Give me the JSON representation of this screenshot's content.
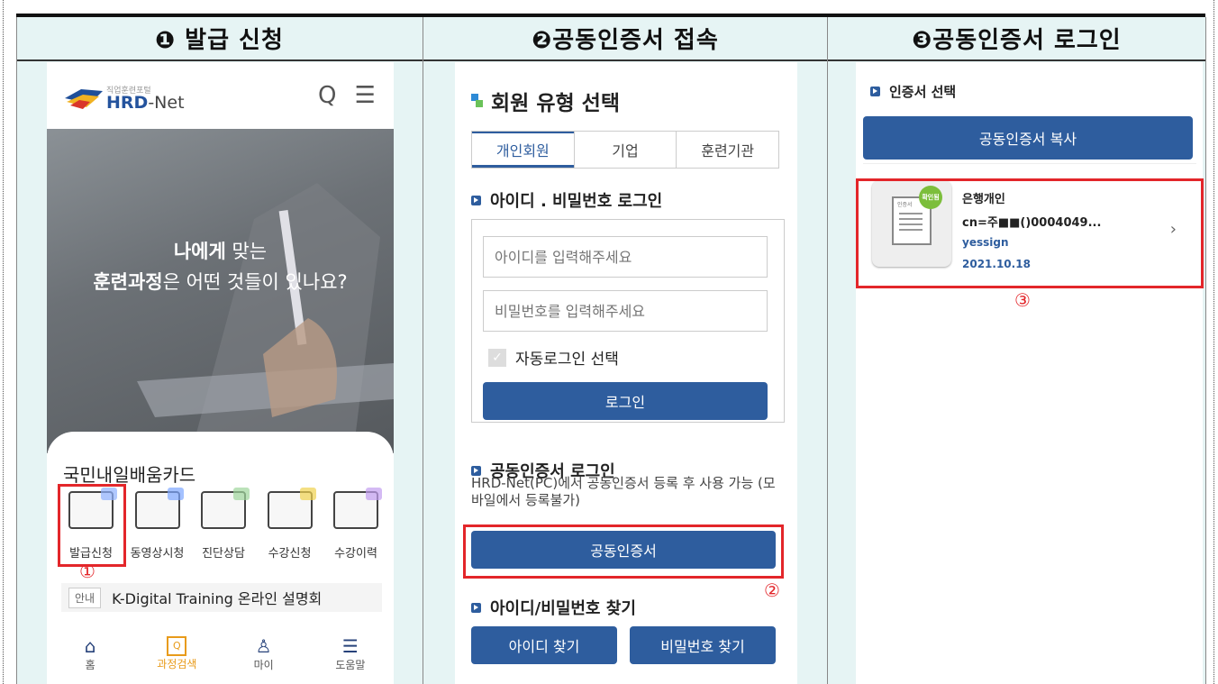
{
  "headers": [
    "❶ 발급 신청",
    "❷공동인증서 접속",
    "❸공동인증서 로그인"
  ],
  "panel1": {
    "logo_small": "직업훈련포털",
    "logo_brand": "HRD",
    "logo_suffix": "-Net",
    "header_icons": "Q ☰",
    "hero_line1_bold": "나에게",
    "hero_line1_rest": " 맞는",
    "hero_line2_bold": "훈련과정",
    "hero_line2_rest": "은 어떤 것들이 있나요?",
    "card_title": "국민내일배움카드",
    "card_menu": [
      "발급신청",
      "동영상시청",
      "진단상담",
      "수강신청",
      "수강이력"
    ],
    "notice_tag": "안내",
    "notice_text": "K-Digital Training 온라인 설명회",
    "nav": [
      {
        "icon": "⌂",
        "label": "홈"
      },
      {
        "icon": "Q",
        "label": "과정검색"
      },
      {
        "icon": "♙",
        "label": "마이"
      },
      {
        "icon": "☰",
        "label": "도움말"
      }
    ],
    "marker": "①"
  },
  "panel2": {
    "title": "회원 유형 선택",
    "tabs": [
      "개인회원",
      "기업",
      "훈련기관"
    ],
    "section_id_login": "아이디 . 비밀번호 로그인",
    "id_placeholder": "아이디를 입력해주세요",
    "pw_placeholder": "비밀번호를 입력해주세요",
    "auto_login": "자동로그인 선택",
    "login_button": "로그인",
    "section_cert": "공동인증서 로그인",
    "cert_desc": "HRD-Net(PC)에서 공동인증서 등록 후 사용 가능 (모바일에서 등록불가)",
    "cert_button": "공동인증서",
    "section_find": "아이디/비밀번호 찾기",
    "find_id": "아이디 찾기",
    "find_pw": "비밀번호 찾기",
    "marker": "②"
  },
  "panel3": {
    "section": "인증서 선택",
    "copy_button": "공동인증서 복사",
    "cert_type": "은행개인",
    "cert_cn": "cn=주■■()0004049...",
    "cert_issuer": "yessign",
    "cert_date": "2021.10.18",
    "seal_text": "확인됨",
    "paper_text": "인증서",
    "marker": "③"
  }
}
